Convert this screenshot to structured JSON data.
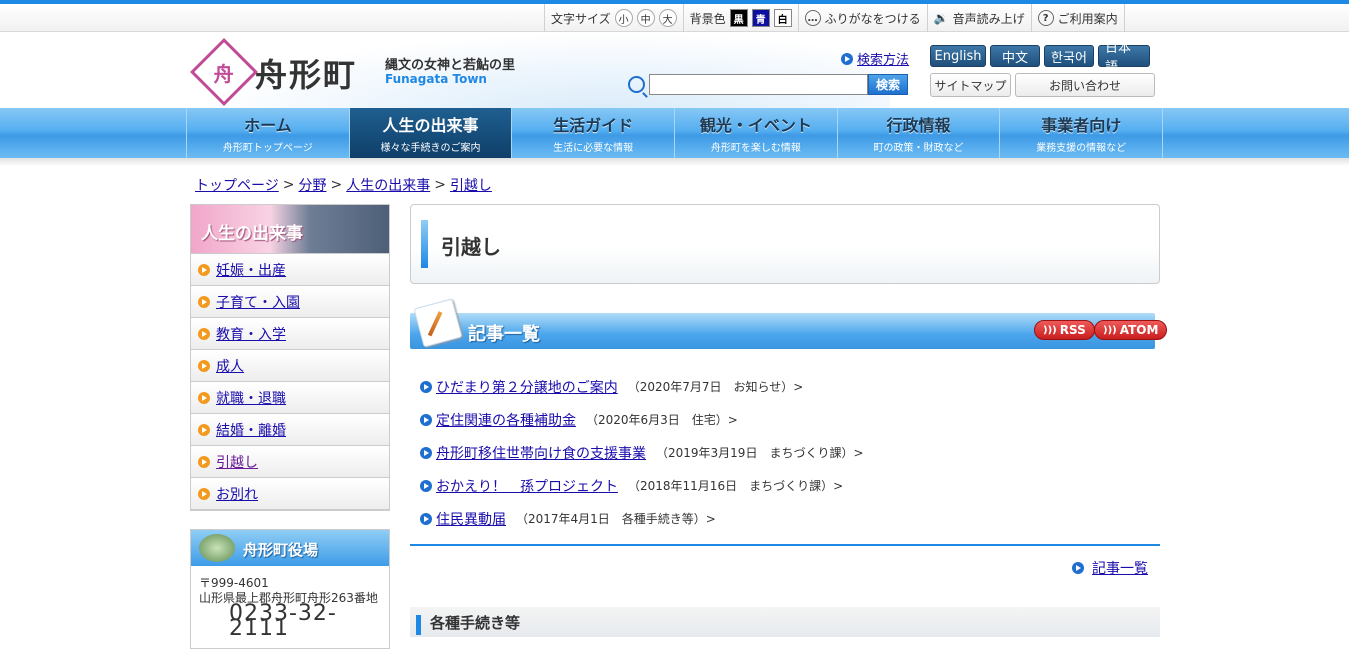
{
  "util": {
    "fontsize_label": "文字サイズ",
    "sizes": [
      "小",
      "中",
      "大"
    ],
    "bg_label": "背景色",
    "bgs": [
      "黒",
      "青",
      "白"
    ],
    "furigana": "ふりがなをつける",
    "speech": "音声読み上げ",
    "guide": "ご利用案内"
  },
  "header": {
    "logo_mark": "舟",
    "logo_text": "舟形町",
    "catch_ja": "縄文の女神と若鮎の里",
    "catch_en": "Funagata Town",
    "search_how": "検索方法",
    "search_button": "検索",
    "search_value": "",
    "langs": [
      "English",
      "中文",
      "한국어",
      "日本語"
    ],
    "sitemap": "サイトマップ",
    "contact": "お問い合わせ"
  },
  "gnav": [
    {
      "main": "ホーム",
      "sub": "舟形町トップページ"
    },
    {
      "main": "人生の出来事",
      "sub": "様々な手続きのご案内"
    },
    {
      "main": "生活ガイド",
      "sub": "生活に必要な情報"
    },
    {
      "main": "観光・イベント",
      "sub": "舟形町を楽しむ情報"
    },
    {
      "main": "行政情報",
      "sub": "町の政策・財政など"
    },
    {
      "main": "事業者向け",
      "sub": "業務支援の情報など"
    }
  ],
  "breadcrumb": [
    "トップページ",
    ">",
    "分野",
    ">",
    "人生の出来事",
    ">",
    "引越し"
  ],
  "side": {
    "title": "人生の出来事",
    "items": [
      "妊娠・出産",
      "子育て・入園",
      "教育・入学",
      "成人",
      "就職・退職",
      "結婚・離婚",
      "引越し",
      "お別れ"
    ]
  },
  "town": {
    "title": "舟形町役場",
    "zip": "〒999-4601",
    "address": "山形県最上郡舟形町舟形263番地",
    "tel": "0233-32-2111"
  },
  "page": {
    "title": "引越し",
    "list_title": "記事一覧",
    "rss": "RSS",
    "atom": "ATOM",
    "more": "記事一覧",
    "section2": "各種手続き等"
  },
  "articles": [
    {
      "title": "ひだまり第２分譲地のご案内",
      "meta": "（2020年7月7日　お知らせ）>"
    },
    {
      "title": "定住関連の各種補助金",
      "meta": "（2020年6月3日　住宅）>"
    },
    {
      "title": "舟形町移住世帯向け食の支援事業",
      "meta": "（2019年3月19日　まちづくり課）>"
    },
    {
      "title": "おかえり！　孫プロジェクト",
      "meta": "（2018年11月16日　まちづくり課）>"
    },
    {
      "title": "住民異動届",
      "meta": "（2017年4月1日　各種手続き等）>"
    }
  ]
}
